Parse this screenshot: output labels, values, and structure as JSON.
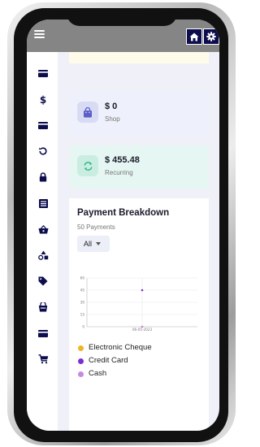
{
  "cards": [
    {
      "value": "$ 0",
      "label": "Shop",
      "icon": "shopping-bag-icon",
      "color": "#5b5fc7"
    },
    {
      "value": "$ 455.48",
      "label": "Recurring",
      "icon": "refresh-icon",
      "color": "#2bb089"
    }
  ],
  "sidebar": {
    "items": [
      {
        "icon": "credit-card-icon"
      },
      {
        "icon": "dollar-icon"
      },
      {
        "icon": "card-icon"
      },
      {
        "icon": "history-icon"
      },
      {
        "icon": "lock-icon"
      },
      {
        "icon": "list-icon"
      },
      {
        "icon": "basket-icon"
      },
      {
        "icon": "shapes-icon"
      },
      {
        "icon": "tag-icon"
      },
      {
        "icon": "bucket-icon"
      },
      {
        "icon": "card-icon"
      },
      {
        "icon": "cart-icon"
      }
    ]
  },
  "topbar": {
    "home_icon": "home-icon",
    "settings_icon": "gear-icon"
  },
  "breakdown": {
    "title": "Payment Breakdown",
    "subtitle": "50 Payments",
    "filter": "All"
  },
  "chart_data": {
    "type": "scatter",
    "x": [
      "06-05-2023"
    ],
    "ylim": [
      0,
      60
    ],
    "yticks": [
      "0",
      "15",
      "30",
      "45",
      "60"
    ],
    "grid": true,
    "series": [
      {
        "name": "Electronic Cheque",
        "values": [
          0
        ],
        "color": "#f0b429"
      },
      {
        "name": "Credit Card",
        "values": [
          45
        ],
        "color": "#7b2fd0"
      },
      {
        "name": "Cash",
        "values": [
          0
        ],
        "color": "#c48be0"
      }
    ],
    "legend": "bottom-left"
  },
  "colors": {
    "accent": "#0d0d4d",
    "topbar": "#858585"
  }
}
